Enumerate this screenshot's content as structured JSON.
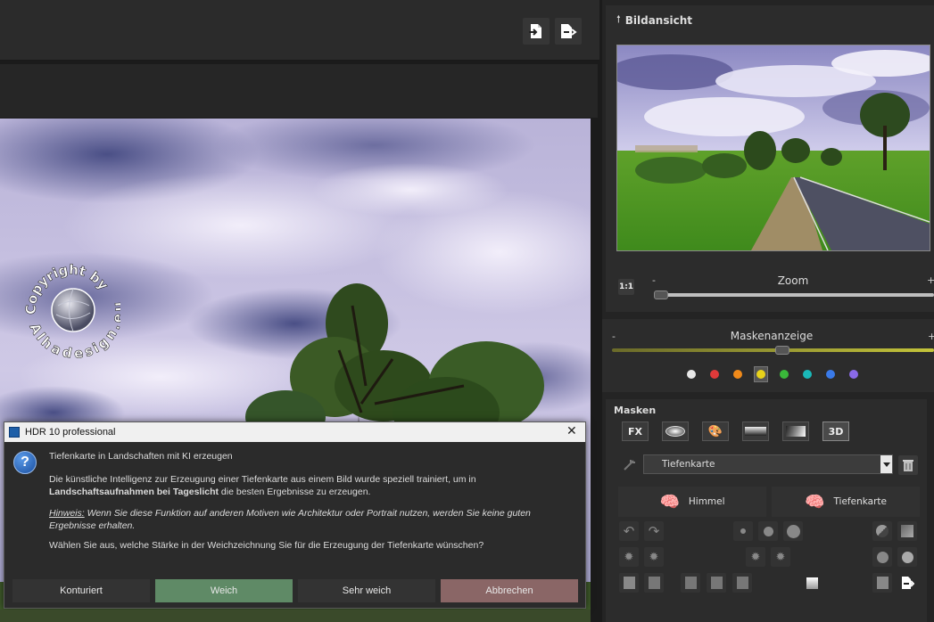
{
  "preview": {
    "title": "Bildansicht"
  },
  "zoom": {
    "label": "Zoom",
    "minus": "-",
    "plus": "+",
    "one_to_one": "1:1",
    "value_fraction": 0.0
  },
  "mask_display": {
    "label": "Maskenanzeige",
    "minus": "-",
    "plus": "+",
    "value_fraction": 0.5,
    "colors": [
      "#e8e8e8",
      "#e03a3a",
      "#f08a1a",
      "#e8d21a",
      "#3ab83a",
      "#1ab8b8",
      "#3a7ae8",
      "#8a6ae8"
    ],
    "selected_index": 3
  },
  "masks": {
    "title": "Masken",
    "tabs": [
      "FX",
      "",
      "",
      "",
      "",
      "3D"
    ],
    "active_tab": "3D",
    "dropdown_value": "Tiefenkarte",
    "ai_himmel": "Himmel",
    "ai_tiefenkarte": "Tiefenkarte"
  },
  "watermark": {
    "line1": "Copyright by",
    "line2": "Alhadesign.eu"
  },
  "dialog": {
    "window_title": "HDR 10 professional",
    "heading": "Tiefenkarte in Landschaften mit KI erzeugen",
    "para1_a": "Die künstliche Intelligenz zur Erzeugung einer Tiefenkarte aus einem Bild wurde speziell trainiert, um in ",
    "para1_b": "Landschaftsaufnahmen bei Tageslicht",
    "para1_c": " die besten Ergebnisse zu erzeugen.",
    "hint_label": "Hinweis:",
    "hint_text": " Wenn Sie diese Funktion auf anderen Motiven wie Architektur oder Portrait nutzen, werden Sie keine guten Ergebnisse erhalten.",
    "question": "Wählen Sie aus, welche Stärke in der Weichzeichnung Sie für die Erzeugung der Tiefenkarte wünschen?",
    "buttons": {
      "konturiert": "Konturiert",
      "weich": "Weich",
      "sehr_weich": "Sehr weich",
      "abbrechen": "Abbrechen"
    }
  }
}
